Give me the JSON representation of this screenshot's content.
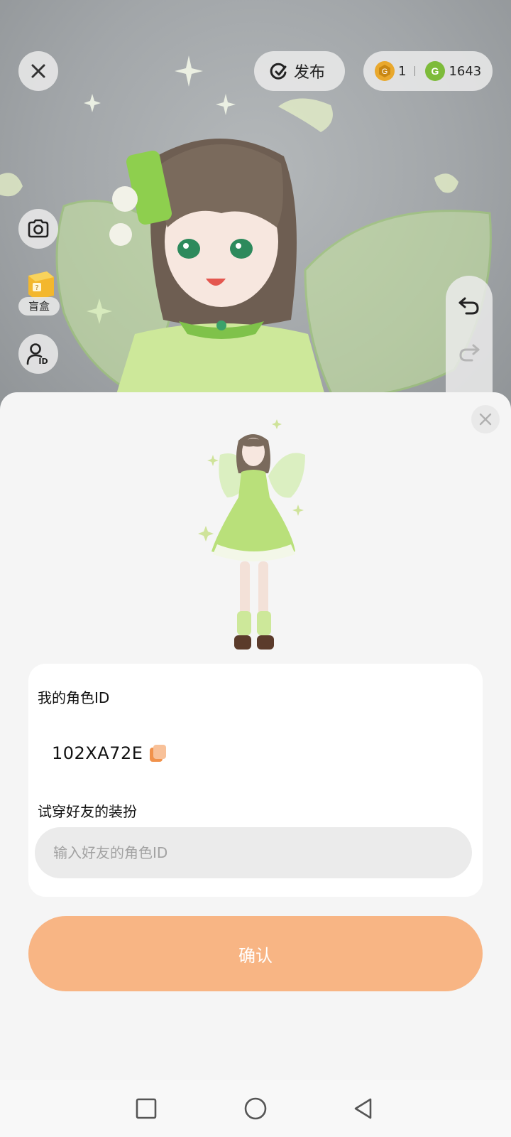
{
  "topbar": {
    "publish_label": "发布",
    "gold_coin_count": "1",
    "green_coin_count": "1643"
  },
  "side_tools": {
    "blind_box_label": "盲盒"
  },
  "sheet": {
    "my_id_label": "我的角色ID",
    "my_id_value": "102XA72E",
    "try_on_label": "试穿好友的装扮",
    "friend_id_placeholder": "输入好友的角色ID",
    "confirm_label": "确认"
  },
  "colors": {
    "accent_orange": "#f8b584",
    "copy_icon": "#f1924b",
    "gold_coin": "#e9a82d",
    "green_coin": "#7dbb3a",
    "outfit_green": "#b9e07a"
  },
  "icons": [
    "close-icon",
    "publish-icon",
    "gold-coin-icon",
    "green-coin-icon",
    "camera-icon",
    "blind-box-icon",
    "profile-id-icon",
    "undo-icon",
    "redo-icon",
    "copy-icon",
    "recent-apps-icon",
    "home-icon",
    "back-icon"
  ]
}
